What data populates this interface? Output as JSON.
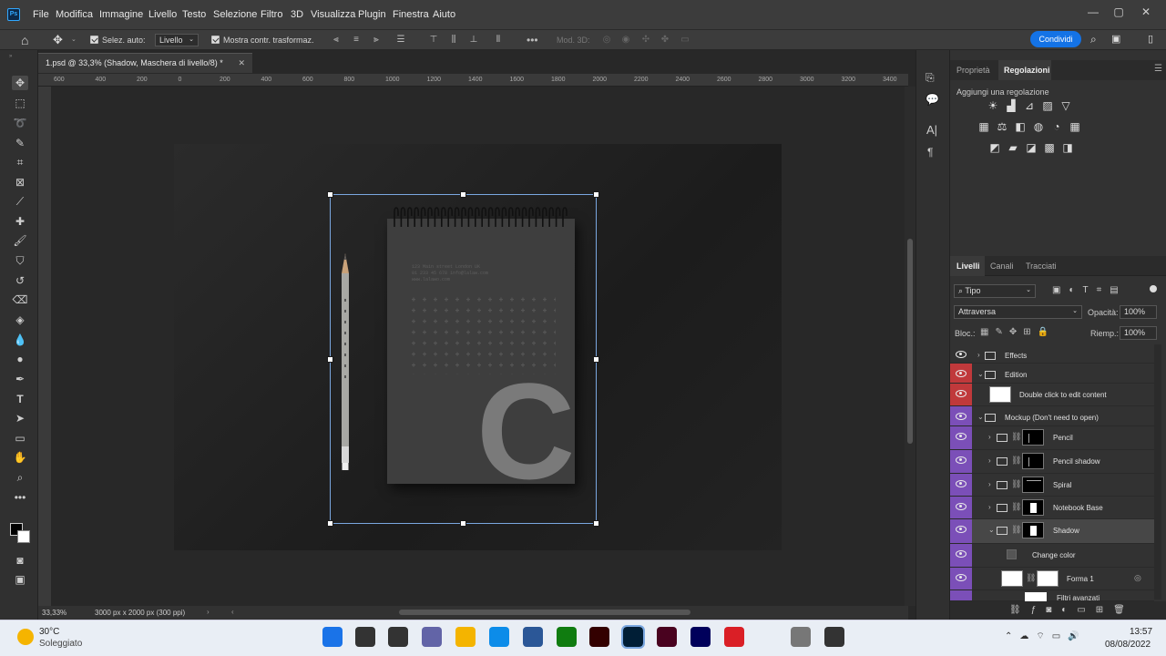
{
  "menu": {
    "items": [
      "File",
      "Modifica",
      "Immagine",
      "Livello",
      "Testo",
      "Selezione",
      "Filtro",
      "3D",
      "Visualizza",
      "Plugin",
      "Finestra",
      "Aiuto"
    ]
  },
  "options": {
    "auto_select_label": "Selez. auto:",
    "auto_select_value": "Livello",
    "transform_label": "Mostra contr. trasformaz.",
    "mode3d_label": "Mod. 3D:",
    "share_label": "Condividi"
  },
  "document": {
    "tab_title": "1.psd @ 33,3% (Shadow, Maschera di livello/8) *",
    "ruler_h": [
      "600",
      "400",
      "200",
      "0",
      "200",
      "400",
      "600",
      "800",
      "1000",
      "1200",
      "1400",
      "1600",
      "1800",
      "2000",
      "2200",
      "2400",
      "2600",
      "2800",
      "3000",
      "3200",
      "3400"
    ],
    "zoom": "33,33%",
    "doc_info": "3000 px x 2000 px (300 ppi)",
    "notebook_text": [
      "123 Main street London UK",
      "01 233 45 678   info@lalaw.com",
      "www.lalawo.com"
    ],
    "notebook_letter": "C"
  },
  "panels": {
    "top_tabs": [
      "Proprietà",
      "Regolazioni"
    ],
    "adjust_title": "Aggiungi una regolazione",
    "layer_tabs": [
      "Livelli",
      "Canali",
      "Tracciati"
    ],
    "filter_kind": "Tipo",
    "blend_mode": "Attraversa",
    "opacity_label": "Opacità:",
    "opacity_value": "100%",
    "lock_label": "Bloc.:",
    "fill_label": "Riemp.:",
    "fill_value": "100%"
  },
  "layers": [
    {
      "name": "Effects",
      "type": "group",
      "color": "none"
    },
    {
      "name": "Edition",
      "type": "group",
      "color": "#c0393b"
    },
    {
      "name": "Double click to edit content",
      "type": "smart",
      "color": "#c0393b"
    },
    {
      "name": "Mockup (Don't need to open)",
      "type": "group",
      "color": "#7b4fb8"
    },
    {
      "name": "Pencil",
      "type": "group-mask",
      "color": "#7b4fb8"
    },
    {
      "name": "Pencil shadow",
      "type": "group-mask",
      "color": "#7b4fb8"
    },
    {
      "name": "Spiral",
      "type": "group-mask",
      "color": "#7b4fb8"
    },
    {
      "name": "Notebook Base",
      "type": "group-mask",
      "color": "#7b4fb8"
    },
    {
      "name": "Shadow",
      "type": "group-mask",
      "color": "#7b4fb8"
    },
    {
      "name": "Change color",
      "type": "fill",
      "color": "#7b4fb8"
    },
    {
      "name": "Forma 1",
      "type": "shape",
      "color": "#7b4fb8"
    },
    {
      "name": "Filtri avanzati",
      "type": "filter",
      "color": "#7b4fb8"
    }
  ],
  "taskbar": {
    "temp": "30°C",
    "weather": "Soleggiato",
    "time": "13:57",
    "date": "08/08/2022"
  }
}
